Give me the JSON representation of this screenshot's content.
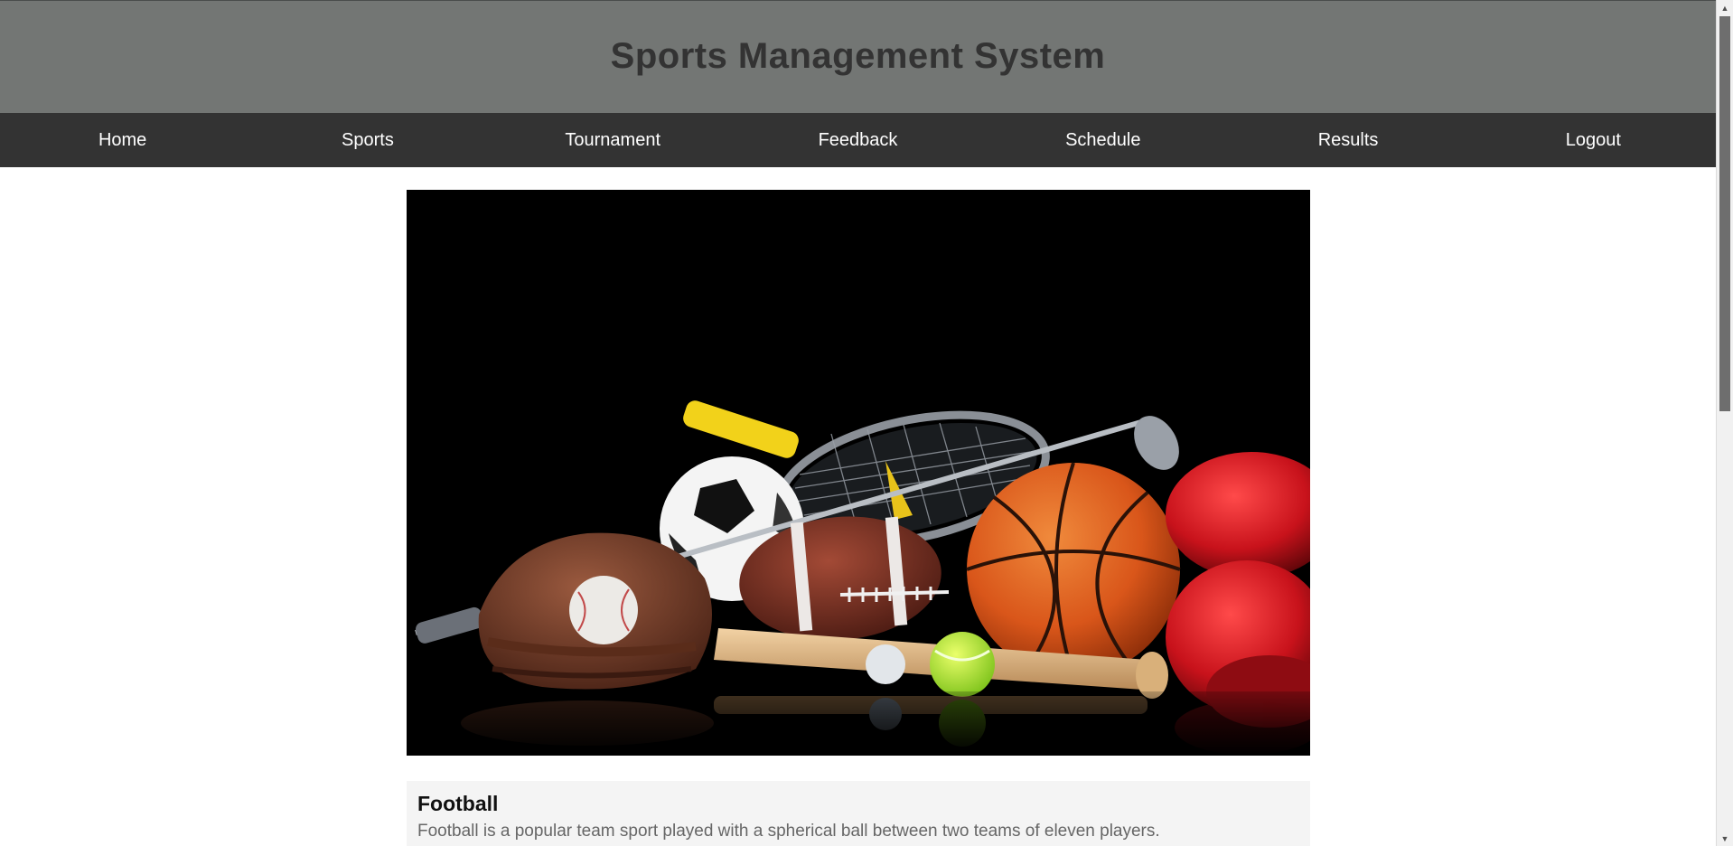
{
  "header": {
    "title": "Sports Management System"
  },
  "nav": {
    "items": [
      {
        "label": "Home"
      },
      {
        "label": "Sports"
      },
      {
        "label": "Tournament"
      },
      {
        "label": "Feedback"
      },
      {
        "label": "Schedule"
      },
      {
        "label": "Results"
      },
      {
        "label": "Logout"
      }
    ]
  },
  "hero": {
    "description": "sports equipment collage"
  },
  "card": {
    "title": "Football",
    "description": "Football is a popular team sport played with a spherical ball between two teams of eleven players."
  },
  "colors": {
    "header_bg": "#737674",
    "nav_bg": "#333333",
    "title_text": "#333333",
    "card_bg": "#f4f4f4"
  }
}
